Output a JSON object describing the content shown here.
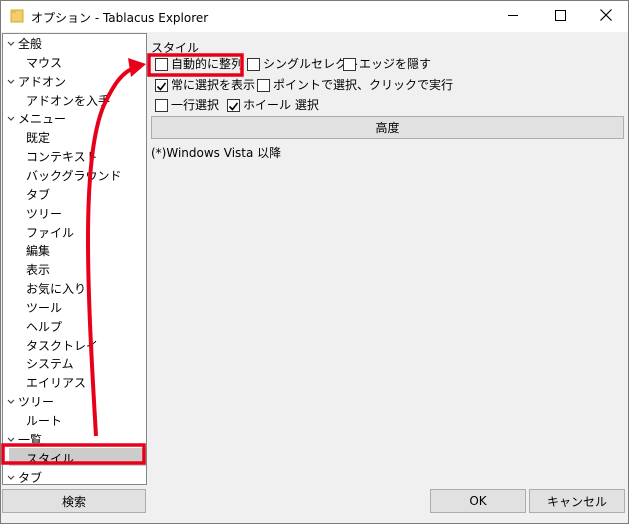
{
  "window": {
    "title": "オプション - Tablacus Explorer",
    "controls": {
      "minimize": "—",
      "maximize": "☐",
      "close": "✕"
    }
  },
  "tree": {
    "items": [
      {
        "label": "全般",
        "level": 0,
        "expanded": true
      },
      {
        "label": "マウス",
        "level": 1
      },
      {
        "label": "アドオン",
        "level": 0,
        "expanded": true
      },
      {
        "label": "アドオンを入手",
        "level": 1
      },
      {
        "label": "メニュー",
        "level": 0,
        "expanded": true
      },
      {
        "label": "既定",
        "level": 1
      },
      {
        "label": "コンテキスト",
        "level": 1
      },
      {
        "label": "バックグラウンド",
        "level": 1
      },
      {
        "label": "タブ",
        "level": 1
      },
      {
        "label": "ツリー",
        "level": 1
      },
      {
        "label": "ファイル",
        "level": 1
      },
      {
        "label": "編集",
        "level": 1
      },
      {
        "label": "表示",
        "level": 1
      },
      {
        "label": "お気に入り",
        "level": 1
      },
      {
        "label": "ツール",
        "level": 1
      },
      {
        "label": "ヘルプ",
        "level": 1
      },
      {
        "label": "タスクトレイ",
        "level": 1
      },
      {
        "label": "システム",
        "level": 1
      },
      {
        "label": "エイリアス",
        "level": 1
      },
      {
        "label": "ツリー",
        "level": 0,
        "expanded": true
      },
      {
        "label": "ルート",
        "level": 1
      },
      {
        "label": "一覧",
        "level": 0,
        "expanded": true
      },
      {
        "label": "スタイル",
        "level": 1,
        "selected": true
      },
      {
        "label": "タブ",
        "level": 0,
        "expanded": true
      }
    ]
  },
  "style_panel": {
    "group_label": "スタイル",
    "options": [
      {
        "label": "自動的に整列",
        "checked": false
      },
      {
        "label": "シングルセレクト",
        "checked": false
      },
      {
        "label": "エッジを隠す",
        "checked": false
      },
      {
        "label": "常に選択を表示",
        "checked": true
      },
      {
        "label": "ポイントで選択、クリックで実行",
        "checked": false
      },
      {
        "label": "一行選択",
        "checked": false
      },
      {
        "label": "ホイール 選択",
        "checked": true
      }
    ],
    "advanced_label": "高度",
    "note": "(*)Windows Vista 以降"
  },
  "buttons": {
    "search": "検索",
    "ok": "OK",
    "cancel": "キャンセル"
  },
  "annotation_color": "#e8001a",
  "selection_color": "#cccccc"
}
